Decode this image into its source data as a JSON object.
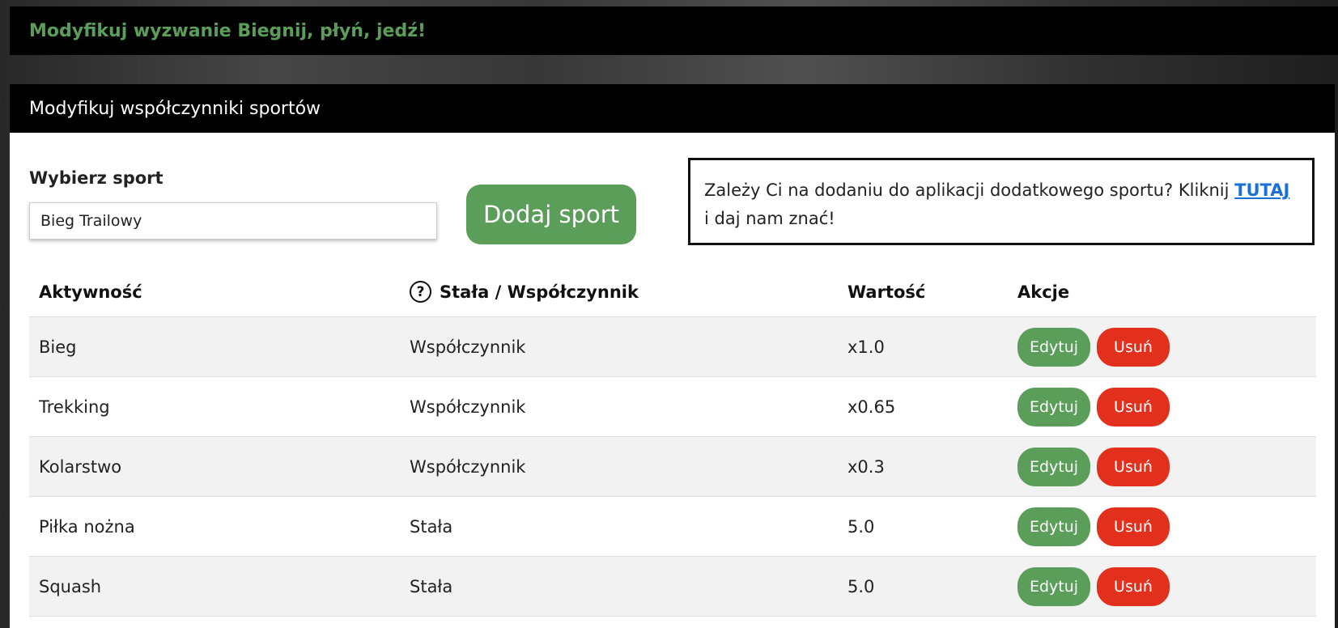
{
  "header": {
    "title": "Modyfikuj wyzwanie Biegnij, płyń, jedź!"
  },
  "panel": {
    "title": "Modyfikuj współczynniki sportów",
    "select_label": "Wybierz sport",
    "select_value": "Bieg Trailowy",
    "add_button": "Dodaj sport",
    "info": {
      "text_before": "Zależy Ci na dodaniu do aplikacji dodatkowego sportu? Kliknij ",
      "link": "TUTAJ",
      "text_after": " i daj nam znać!"
    }
  },
  "table": {
    "headers": [
      "Aktywność",
      "Stała / Współczynnik",
      "Wartość",
      "Akcje"
    ],
    "rows": [
      {
        "activity": "Bieg",
        "type": "Współczynnik",
        "value": "x1.0"
      },
      {
        "activity": "Trekking",
        "type": "Współczynnik",
        "value": "x0.65"
      },
      {
        "activity": "Kolarstwo",
        "type": "Współczynnik",
        "value": "x0.3"
      },
      {
        "activity": "Piłka nożna",
        "type": "Stała",
        "value": "5.0"
      },
      {
        "activity": "Squash",
        "type": "Stała",
        "value": "5.0"
      }
    ],
    "edit_label": "Edytuj",
    "delete_label": "Usuń"
  }
}
